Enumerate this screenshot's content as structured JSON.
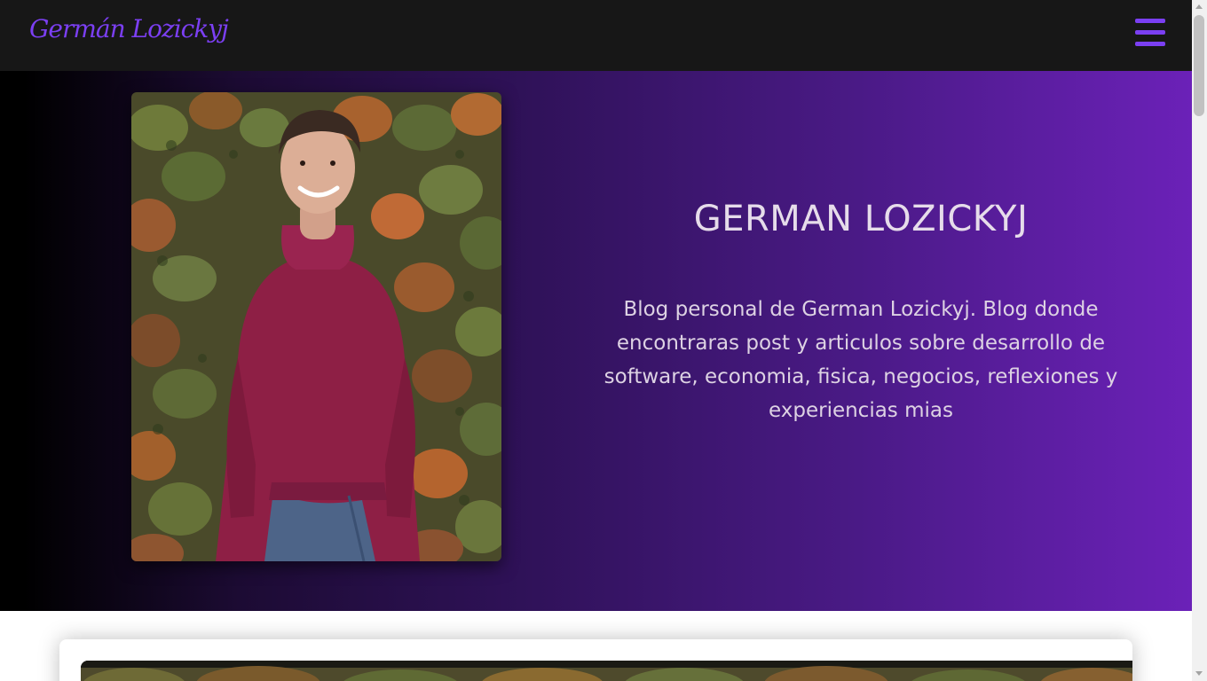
{
  "header": {
    "logo_text": "Germán Lozickyj",
    "menu_icon": "hamburger-menu-icon",
    "accent_color": "#7b3ff2"
  },
  "hero": {
    "title": "GERMAN LOZICKYJ",
    "description": "Blog personal de German Lozickyj. Blog donde encontraras post y articulos sobre desarrollo de software, economia, fisica, negocios, reflexiones y experiencias mias",
    "gradient_colors": [
      "#000000",
      "#30125a",
      "#6b21b8"
    ],
    "portrait_image": "profile-photo"
  },
  "card": {
    "image": "post-cover-photo"
  }
}
